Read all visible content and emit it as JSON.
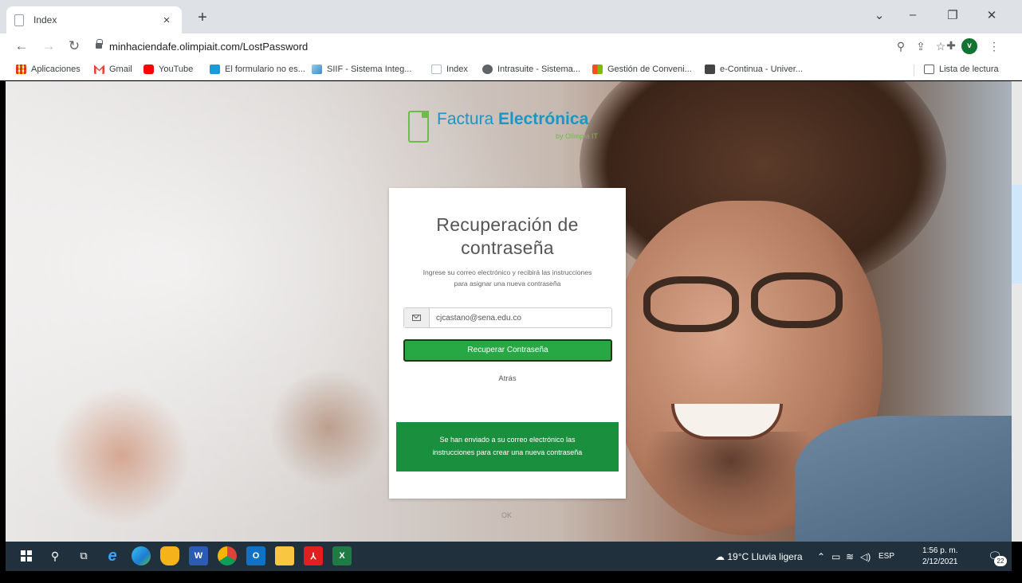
{
  "browser": {
    "tab_title": "Index",
    "tab_close": "×",
    "new_tab": "+",
    "url": "minhaciendafe.olimpiait.com/LostPassword",
    "avatar_letter": "v",
    "window_controls": {
      "minimize": "–",
      "restore": "❐",
      "close": "✕",
      "dropdown": "⌄"
    },
    "toolbar_icons": [
      "zoom-icon",
      "share-icon",
      "star-icon",
      "extensions-icon"
    ],
    "bookmarks": [
      {
        "label": "Aplicaciones",
        "icon": "apps-icon",
        "color": "#ea4335"
      },
      {
        "label": "Gmail",
        "icon": "gmail-icon",
        "color": "#ea4335"
      },
      {
        "label": "YouTube",
        "icon": "youtube-icon",
        "color": "#ff0000"
      },
      {
        "label": "El formulario no es...",
        "icon": "forms-icon",
        "color": "#1a9bd7"
      },
      {
        "label": "SIIF - Sistema Integ...",
        "icon": "siif-icon",
        "color": "#3f86c6"
      },
      {
        "label": "Index",
        "icon": "page-icon",
        "color": "#cfd8dc"
      },
      {
        "label": "Intrasuite - Sistema...",
        "icon": "globe-icon",
        "color": "#5f6368"
      },
      {
        "label": "Gestión de Conveni...",
        "icon": "windows-icon",
        "color": "#f25022"
      },
      {
        "label": "e-Continua - Univer...",
        "icon": "econtinua-icon",
        "color": "#444"
      }
    ],
    "reading_list": "Lista de lectura"
  },
  "page": {
    "logo": {
      "prefix": "Factura ",
      "strong": "Electrónica",
      "sub": "by Olimpia IT",
      "green": "#6cbd45",
      "blue": "#1996c8"
    },
    "card": {
      "title_line1": "Recuperación de",
      "title_line2": "contraseña",
      "desc_line1": "Ingrese su correo electrónico y recibirá las instrucciones",
      "desc_line2": "para asignar una nueva contraseña",
      "email_value": "cjcastano@sena.edu.co",
      "submit_label": "Recuperar Contraseña",
      "back_label": "Atrás",
      "alert_line1": "Se han enviado a su correo electrónico las",
      "alert_line2": "instrucciones para crear una nueva contraseña",
      "alert_color": "#1a8f3e",
      "button_color": "#28a745"
    },
    "ghost_ok": "OK"
  },
  "taskbar": {
    "apps": [
      "windows-start-icon",
      "search-icon",
      "task-view-icon",
      "edge-legacy-icon",
      "edge-icon",
      "security-icon",
      "word-icon",
      "chrome-icon",
      "outlook-icon",
      "file-explorer-icon",
      "acrobat-icon",
      "excel-icon"
    ],
    "weather": "19°C  Lluvia ligera",
    "language": "ESP",
    "time": "1:56 p. m.",
    "date": "2/12/2021",
    "notifications": "22"
  }
}
